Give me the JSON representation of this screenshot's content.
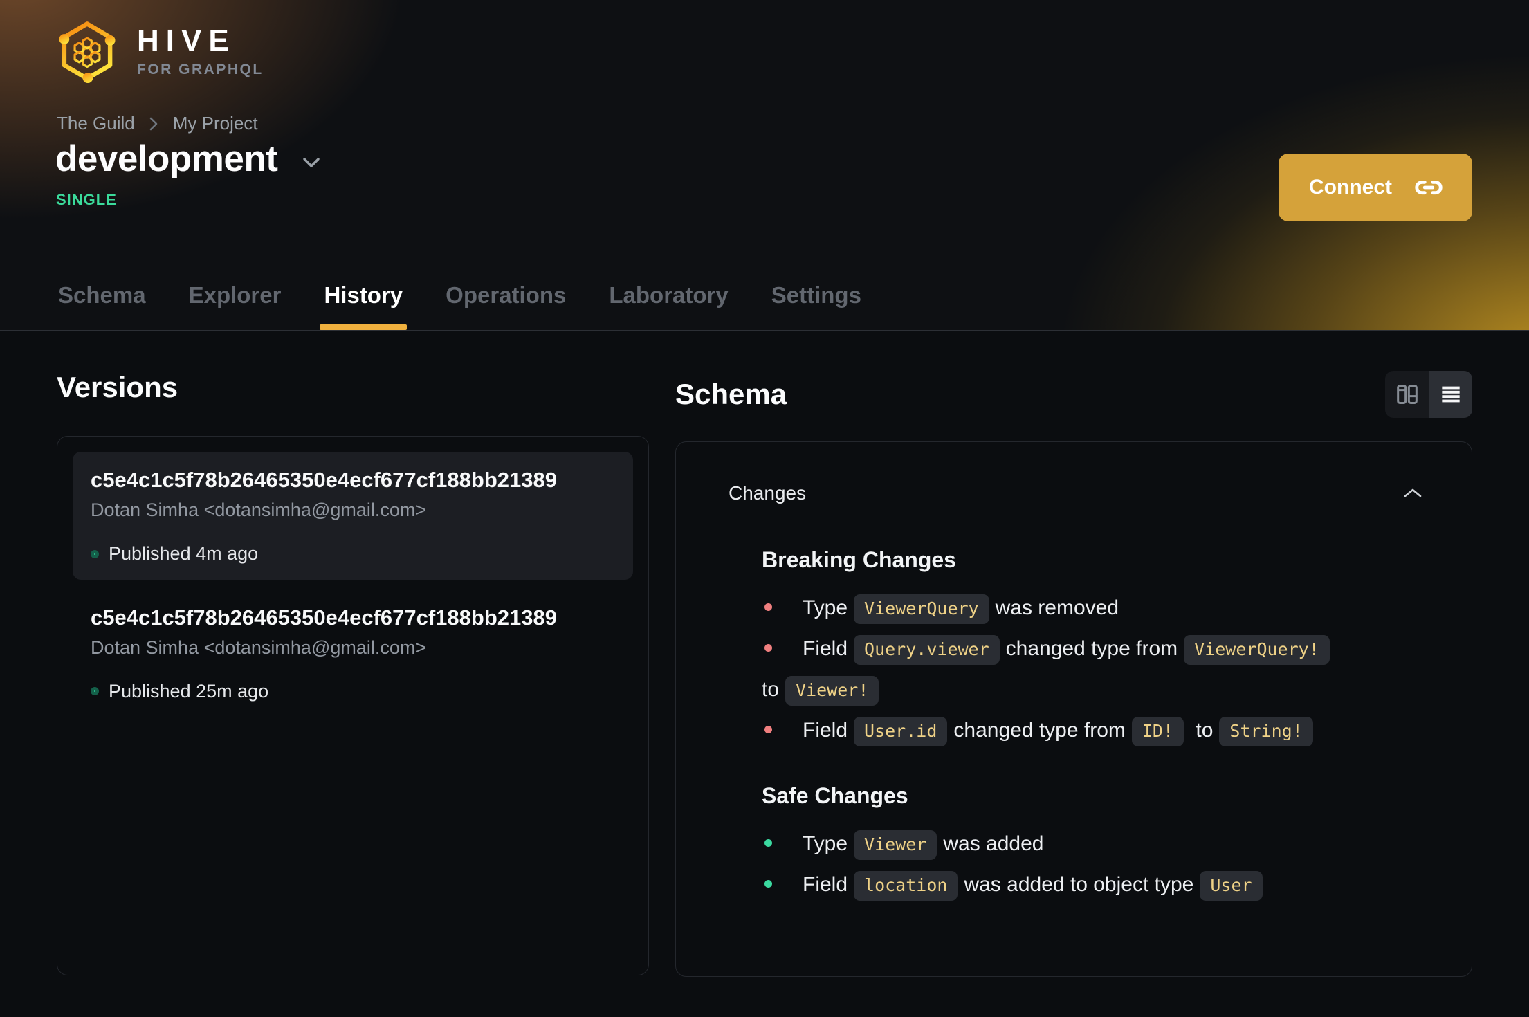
{
  "brand": {
    "name": "HIVE",
    "tagline": "FOR GRAPHQL"
  },
  "breadcrumb": {
    "org": "The Guild",
    "project": "My Project"
  },
  "target": {
    "name": "development",
    "badge": "SINGLE"
  },
  "actions": {
    "connect_label": "Connect",
    "connect_icon": "link-icon"
  },
  "tabs": [
    {
      "label": "Schema",
      "active": false
    },
    {
      "label": "Explorer",
      "active": false
    },
    {
      "label": "History",
      "active": true
    },
    {
      "label": "Operations",
      "active": false
    },
    {
      "label": "Laboratory",
      "active": false
    },
    {
      "label": "Settings",
      "active": false
    }
  ],
  "versions": {
    "heading": "Versions",
    "items": [
      {
        "hash": "c5e4c1c5f78b26465350e4ecf677cf188bb21389",
        "author": "Dotan Simha <dotansimha@gmail.com>",
        "status": "Published 4m ago",
        "highlighted": true
      },
      {
        "hash": "c5e4c1c5f78b26465350e4ecf677cf188bb21389",
        "author": "Dotan Simha <dotansimha@gmail.com>",
        "status": "Published 25m ago",
        "highlighted": false
      }
    ]
  },
  "schema_panel": {
    "heading": "Schema",
    "view_toggle": {
      "options": [
        {
          "icon": "split-view-icon",
          "selected": false
        },
        {
          "icon": "list-view-icon",
          "selected": true
        }
      ]
    },
    "changes": {
      "title": "Changes",
      "collapse_icon": "chevron-up-icon",
      "breaking": {
        "title": "Breaking Changes",
        "items": [
          {
            "p0": "Type",
            "c0": "ViewerQuery",
            "p1": "was removed"
          },
          {
            "p0": "Field",
            "c0": "Query.viewer",
            "p1": "changed type from",
            "c1": "ViewerQuery!",
            "p2": "to",
            "c2": "Viewer!"
          },
          {
            "p0": "Field",
            "c0": "User.id",
            "p1": "changed type from",
            "c1": "ID!",
            "p2": "to",
            "c2": "String!"
          }
        ]
      },
      "safe": {
        "title": "Safe Changes",
        "items": [
          {
            "p0": "Type",
            "c0": "Viewer",
            "p1": "was added"
          },
          {
            "p0": "Field",
            "c0": "location",
            "p1": "was added to object type",
            "c1": "User"
          }
        ]
      }
    }
  },
  "colors": {
    "accent": "#f0b13e",
    "connect_bg": "#d5a23a",
    "badge_green": "#3bdb9b",
    "status_dot": "#2fd39a",
    "breaking_bullet": "#f07f7f",
    "safe_bullet": "#3bd9a0",
    "code_text": "#efd287"
  }
}
